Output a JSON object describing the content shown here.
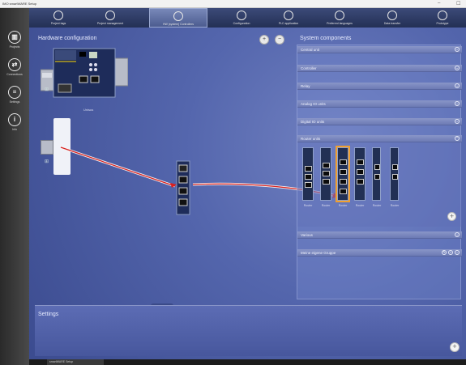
{
  "window": {
    "title": "IMO smartWARE Setup",
    "minimize": "–",
    "close": "☐"
  },
  "sidebar": {
    "items": [
      {
        "label": "Projects",
        "icon": "projects-icon",
        "glyph": "▥"
      },
      {
        "label": "Connections",
        "icon": "connections-icon",
        "glyph": "⇄"
      },
      {
        "label": "Settings",
        "icon": "settings-list-icon",
        "glyph": "≡"
      },
      {
        "label": "Info",
        "icon": "info-icon",
        "glyph": "i"
      }
    ]
  },
  "toolbar": {
    "items": [
      {
        "label": "Project tags",
        "icon": "home-icon"
      },
      {
        "label": "Project management",
        "icon": "compass-icon"
      },
      {
        "label": "HW (system) Controllers",
        "icon": "controller-icon"
      },
      {
        "label": "Configuration",
        "icon": "configuration-icon"
      },
      {
        "label": "PLC application",
        "icon": "plc-icon"
      },
      {
        "label": "Preferred languages",
        "icon": "languages-icon"
      },
      {
        "label": "Data transfer",
        "icon": "transfer-icon"
      },
      {
        "label": "Prototype",
        "icon": "prototype-icon"
      }
    ]
  },
  "hardware": {
    "title": "Hardware configuration",
    "zoom_in": "+",
    "zoom_out": "−",
    "main_device_label": "Unisus",
    "slot_marker": "⊞"
  },
  "system_components": {
    "title": "System components",
    "categories": [
      "Central unit",
      "Controller",
      "Relay",
      "Analog IO units",
      "Digital IO units",
      "Router units"
    ],
    "router_modules": [
      "Router",
      "Router",
      "Router",
      "Router",
      "Router",
      "Router"
    ],
    "lower_categories": [
      "Various",
      "Meine eigene Gruppe"
    ],
    "add_label": "+"
  },
  "settings": {
    "title": "Settings",
    "collapse": "⌄",
    "add_label": "+"
  },
  "statusbar": {
    "tab": "smartWARE Setup"
  },
  "colors": {
    "accent": "#5466ad",
    "selected_module": "#f0a030",
    "link_red": "#d82020"
  }
}
